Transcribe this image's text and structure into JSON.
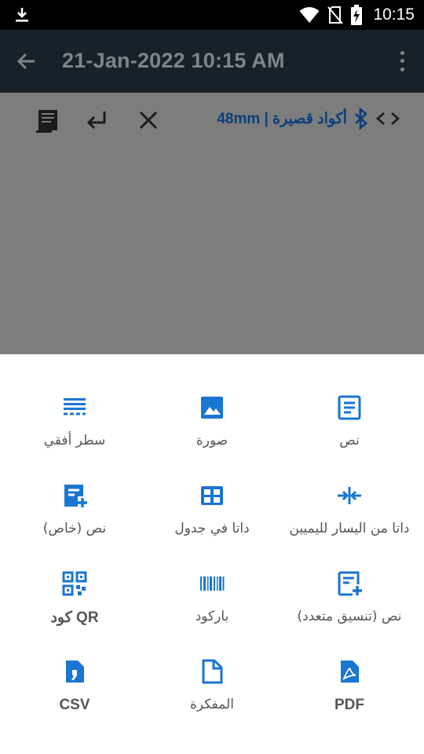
{
  "status_bar": {
    "time": "10:15",
    "icons": [
      "download-icon",
      "wifi-icon",
      "no-sim-icon",
      "battery-charging-icon"
    ]
  },
  "app_bar": {
    "title": "21-Jan-2022 10:15 AM",
    "back_icon": "arrow-back-icon",
    "menu_icon": "more-vert-icon"
  },
  "toolbar": {
    "icons": [
      "receipt-roll-icon",
      "return-icon",
      "close-icon"
    ],
    "printer_label": "أكواد قصيرة | 48mm",
    "bluetooth_icon": "bluetooth-icon",
    "code_icon": "code-icon"
  },
  "sheet": {
    "items": [
      {
        "label": "سطر أفقي",
        "icon": "horizontal-line-icon"
      },
      {
        "label": "صورة",
        "icon": "image-icon"
      },
      {
        "label": "نص",
        "icon": "text-icon"
      },
      {
        "label": "نص (خاص)",
        "icon": "special-text-icon"
      },
      {
        "label": "داتا في جدول",
        "icon": "table-icon"
      },
      {
        "label": "داتا من اليسار لليميين",
        "icon": "left-right-data-icon"
      },
      {
        "label": "كود QR",
        "icon": "qr-code-icon"
      },
      {
        "label": "باركود",
        "icon": "barcode-icon"
      },
      {
        "label": "نص (تنسيق متعدد)",
        "icon": "multi-format-text-icon"
      },
      {
        "label": "CSV",
        "icon": "csv-icon"
      },
      {
        "label": "المفكرة",
        "icon": "notepad-icon"
      },
      {
        "label": "PDF",
        "icon": "pdf-icon"
      }
    ]
  },
  "colors": {
    "accent": "#1976d2",
    "status_bar": "#000000",
    "app_bar_dim": "#17212a",
    "scrim": "#7d7d7d",
    "label_text": "#555555"
  }
}
